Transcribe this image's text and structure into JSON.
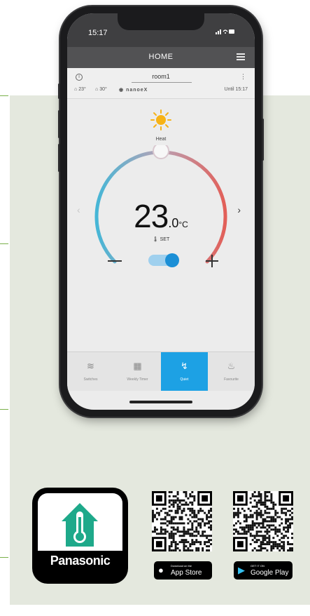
{
  "status_bar": {
    "time": "15:17",
    "icons": "signal-wifi-battery"
  },
  "nav": {
    "title": "HOME"
  },
  "room": {
    "name": "room1",
    "indoor": "23°",
    "outdoor": "30°",
    "brand_feature": "nanoeX",
    "updated": "Until 15:17"
  },
  "mode": {
    "label": "Heat"
  },
  "temperature": {
    "whole": "23",
    "decimal": ".0",
    "unit": "°C",
    "set_label": "SET"
  },
  "tabs": [
    {
      "label": "Switches",
      "icon": "fan-icon"
    },
    {
      "label": "Weekly Timer",
      "icon": "calendar-icon"
    },
    {
      "label": "Quiet",
      "icon": "quiet-icon"
    },
    {
      "label": "Favourite",
      "icon": "favourite-icon"
    }
  ],
  "app_icon": {
    "brand": "Panasonic"
  },
  "stores": [
    {
      "small": "Download on the",
      "big": "App Store",
      "icon": "apple-icon"
    },
    {
      "small": "GET IT ON",
      "big": "Google Play",
      "icon": "play-icon"
    }
  ],
  "colors": {
    "accent": "#1da1e4",
    "dial_cool": "#4ab8d8",
    "dial_warm": "#e0605a",
    "app_green": "#1ea98a",
    "panel": "#e4e8de"
  }
}
